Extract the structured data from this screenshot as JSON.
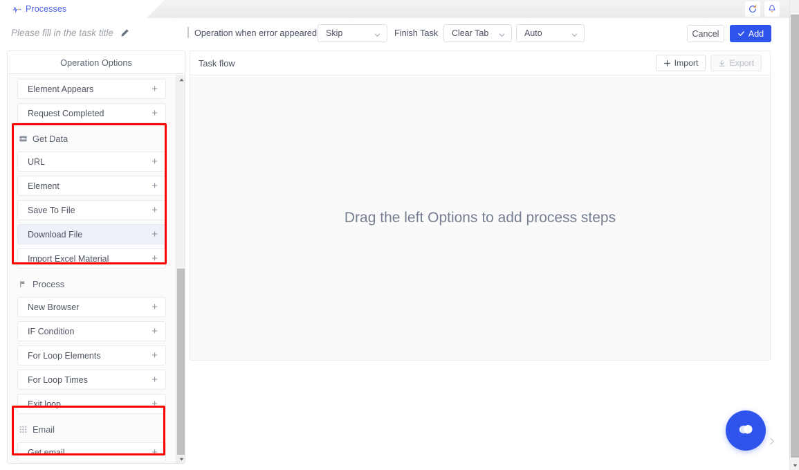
{
  "tab": {
    "label": "Processes",
    "icon": "activity-pulse-icon"
  },
  "tabbar_actions": [
    {
      "name": "refresh-icon",
      "label": "refresh"
    },
    {
      "name": "bell-icon",
      "label": "notifications"
    }
  ],
  "toolbar": {
    "task_title_placeholder": "Please fill in the task title",
    "edit_icon": "pencil-icon",
    "error_label": "Operation when error appeared",
    "error_value": "Skip",
    "finish_label": "Finish Task",
    "finish_value": "Clear Tab",
    "mode_value": "Auto",
    "cancel_label": "Cancel",
    "add_label": "Add"
  },
  "sidebar": {
    "header": "Operation Options",
    "groups": [
      {
        "name": "ungrouped-top",
        "title": null,
        "icon": null,
        "items": [
          {
            "label": "Element Appears",
            "action": "+",
            "hovered": false
          },
          {
            "label": "Request Completed",
            "action": "+",
            "hovered": false
          }
        ]
      },
      {
        "name": "get-data",
        "title": "Get Data",
        "icon": "inbox-icon",
        "highlighted": true,
        "items": [
          {
            "label": "URL",
            "action": "+",
            "hovered": false
          },
          {
            "label": "Element",
            "action": "+",
            "hovered": false
          },
          {
            "label": "Save To File",
            "action": "+",
            "hovered": false
          },
          {
            "label": "Download File",
            "action": "+",
            "hovered": true
          },
          {
            "label": "Import Excel Material",
            "action": "+",
            "hovered": false
          }
        ]
      },
      {
        "name": "process",
        "title": "Process",
        "icon": "flag-icon",
        "highlighted": false,
        "items": [
          {
            "label": "New Browser",
            "action": "+",
            "hovered": false
          },
          {
            "label": "IF Condition",
            "action": "+",
            "hovered": false
          },
          {
            "label": "For Loop Elements",
            "action": "+",
            "hovered": false
          },
          {
            "label": "For Loop Times",
            "action": "+",
            "hovered": false
          },
          {
            "label": "Exit loop",
            "action": "+",
            "hovered": false
          }
        ]
      },
      {
        "name": "email",
        "title": "Email",
        "icon": "grid-dots-icon",
        "highlighted": true,
        "items": [
          {
            "label": "Get email",
            "action": "+",
            "hovered": false
          }
        ]
      }
    ]
  },
  "main": {
    "title": "Task flow",
    "import_label": "Import",
    "export_label": "Export",
    "export_disabled": true,
    "empty_text": "Drag the left Options to add process steps"
  },
  "chat": {
    "icon": "chat-bubble-icon"
  },
  "colors": {
    "accent": "#2f54eb",
    "tab_text": "#4a5fe8",
    "annotation": "#ff0000",
    "hover_bg": "#eef0fa",
    "canvas_bg": "#fafafb"
  }
}
